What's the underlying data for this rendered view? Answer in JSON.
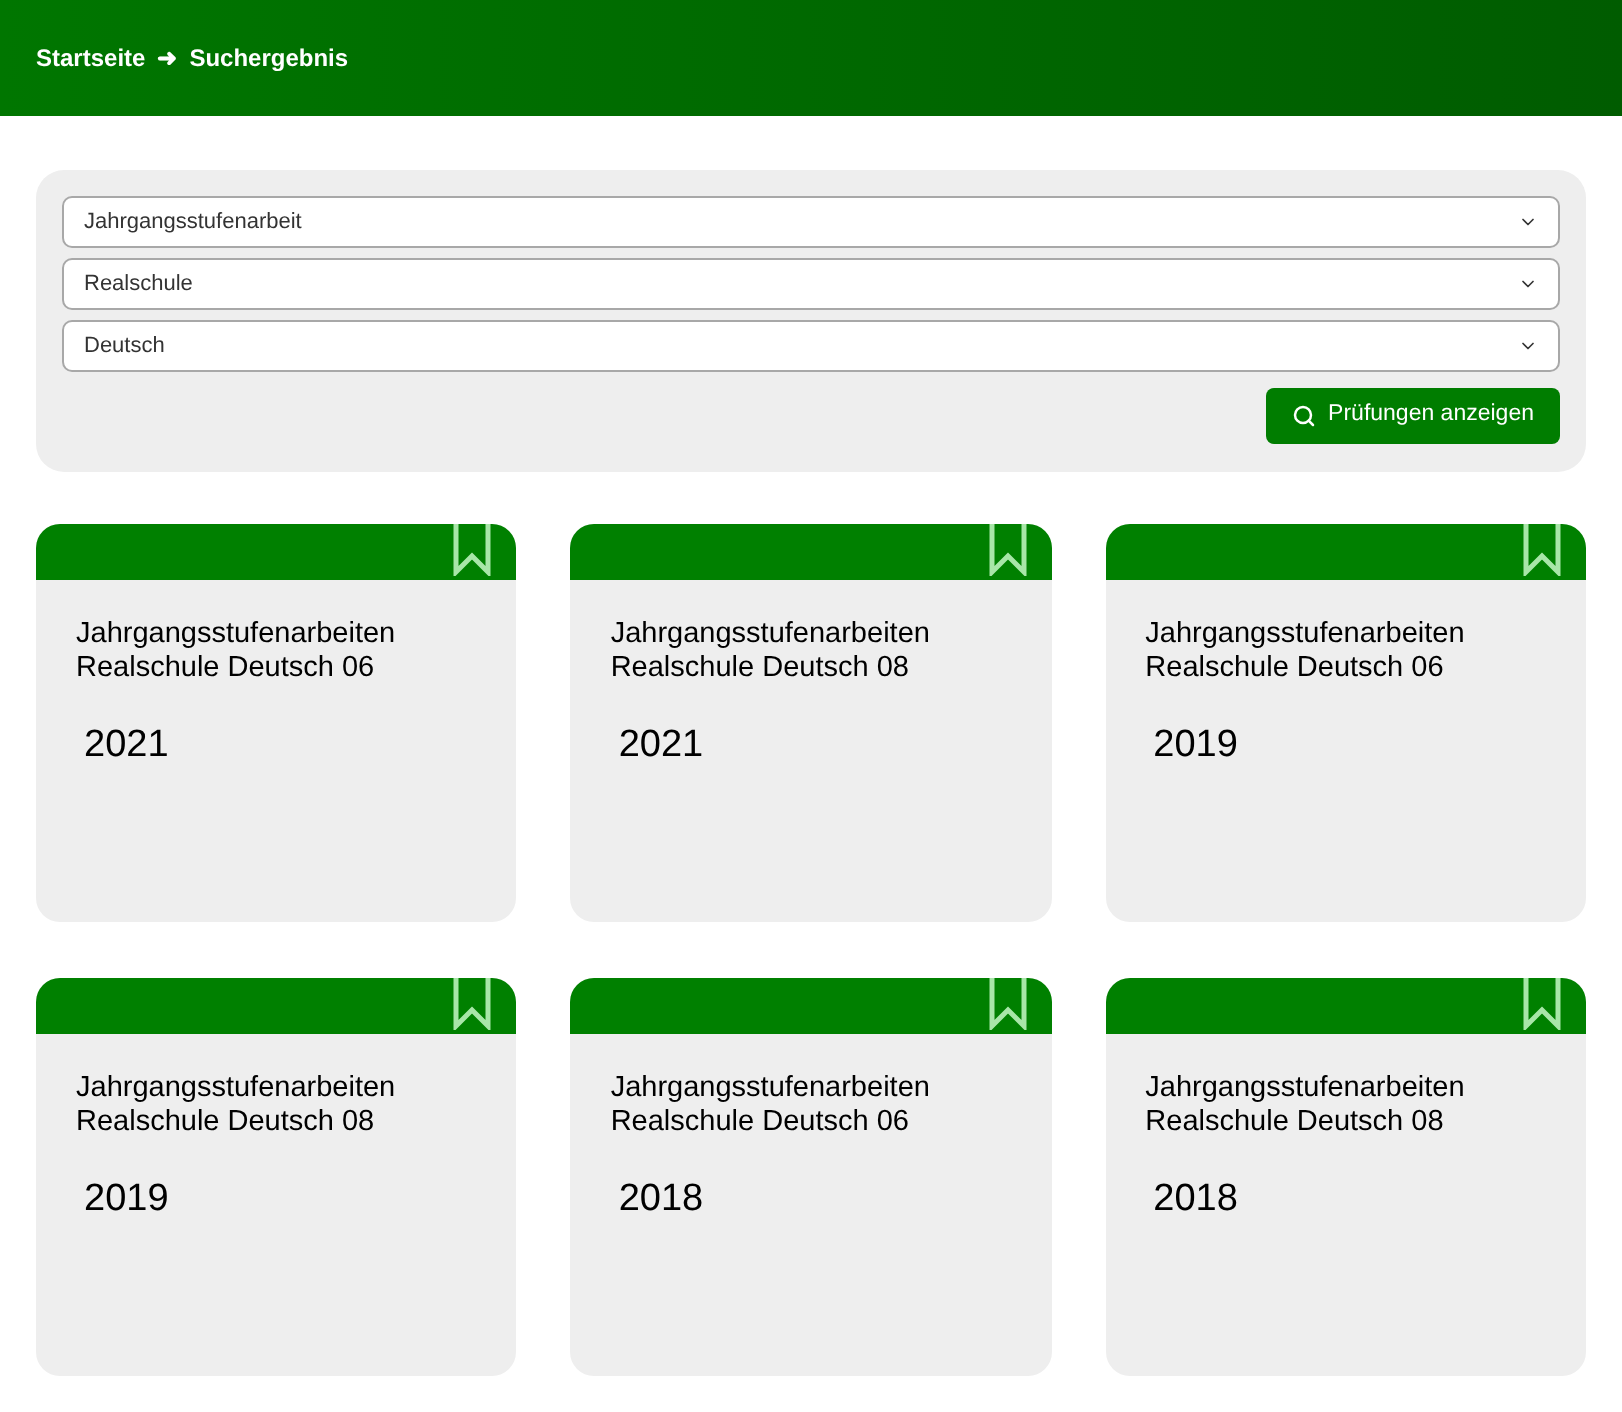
{
  "breadcrumb": {
    "items": [
      "Startseite",
      "Suchergebnis"
    ],
    "separator": "➜"
  },
  "filters": {
    "selects": [
      {
        "value": "Jahrgangsstufenarbeit"
      },
      {
        "value": "Realschule"
      },
      {
        "value": "Deutsch"
      }
    ],
    "button": "Prüfungen anzeigen"
  },
  "cards": [
    {
      "title": "Jahrgangsstufenarbeiten Realschule Deutsch 06",
      "year": "2021",
      "bookmarked": false
    },
    {
      "title": "Jahrgangsstufenarbeiten Realschule Deutsch 08",
      "year": "2021",
      "bookmarked": false
    },
    {
      "title": "Jahrgangsstufenarbeiten Realschule Deutsch 06",
      "year": "2019",
      "bookmarked": false
    },
    {
      "title": "Jahrgangsstufenarbeiten Realschule Deutsch 08",
      "year": "2019",
      "bookmarked": false
    },
    {
      "title": "Jahrgangsstufenarbeiten Realschule Deutsch 06",
      "year": "2018",
      "bookmarked": false
    },
    {
      "title": "Jahrgangsstufenarbeiten Realschule Deutsch 08",
      "year": "2018",
      "bookmarked": false
    }
  ]
}
